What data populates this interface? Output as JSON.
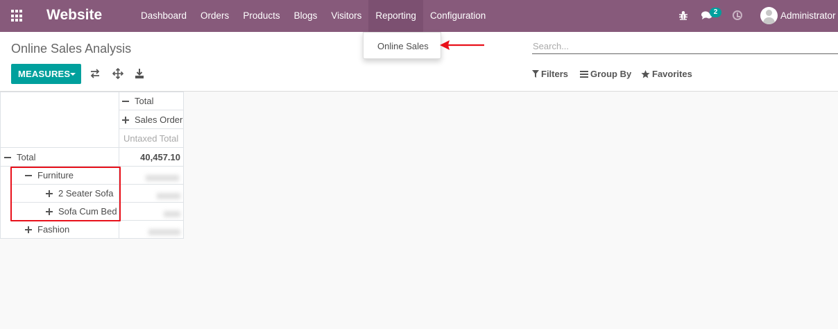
{
  "navbar": {
    "brand": "Website",
    "menu": [
      {
        "label": "Dashboard"
      },
      {
        "label": "Orders"
      },
      {
        "label": "Products"
      },
      {
        "label": "Blogs"
      },
      {
        "label": "Visitors"
      },
      {
        "label": "Reporting"
      },
      {
        "label": "Configuration"
      }
    ],
    "chat_badge": "2",
    "user_name": "Administrator",
    "icons": [
      "apps-grid-icon",
      "bug-icon",
      "chat-icon",
      "clock-icon",
      "avatar"
    ]
  },
  "dropdown": {
    "items": [
      {
        "label": "Online Sales"
      }
    ]
  },
  "control_panel": {
    "title": "Online Sales Analysis",
    "measures_label": "MEASURES",
    "search_placeholder": "Search...",
    "filters_label": "Filters",
    "group_by_label": "Group By",
    "favorites_label": "Favorites"
  },
  "pivot": {
    "col_header": "Total",
    "col_sub_header": "Sales Order",
    "measure_header": "Untaxed Total",
    "rows": [
      {
        "label": "Total",
        "value": "40,457.10",
        "level": 0,
        "expanded": true
      },
      {
        "label": "Furniture",
        "value": "",
        "level": 1,
        "expanded": true
      },
      {
        "label": "2 Seater Sofa",
        "value": "",
        "level": 2,
        "expanded": false
      },
      {
        "label": "Sofa Cum Bed",
        "value": "",
        "level": 2,
        "expanded": false
      },
      {
        "label": "Fashion",
        "value": "",
        "level": 1,
        "expanded": false
      }
    ]
  },
  "colors": {
    "navbar": "#875a7b",
    "primary_button": "#00a09d",
    "highlight_annotation": "#e8101a"
  }
}
